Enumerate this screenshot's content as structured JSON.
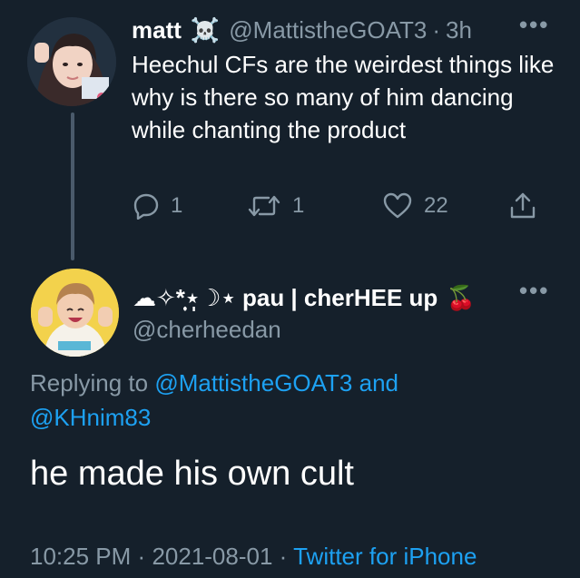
{
  "parent_tweet": {
    "display_name": "matt",
    "name_emoji": "☠️",
    "handle": "@MattistheGOAT3",
    "separator": "·",
    "time": "3h",
    "text": "Heechul CFs are the weirdest things like why is there so many of him dancing while chanting the product",
    "reply_count": "1",
    "retweet_count": "1",
    "like_count": "22",
    "avatar_icon": "profile-photo"
  },
  "reply_tweet": {
    "display_name": "☁︎✧*̣̩⋆̩☽⋆ pau | cherHEE up",
    "name_emoji": "🍒",
    "handle": "@cherheedan",
    "replying_prefix": "Replying to",
    "replying_user1": "@MattistheGOAT3",
    "replying_and": "and",
    "replying_user2": "@KHnim83",
    "text": "he made his own cult",
    "time": "10:25 PM",
    "date": "2021-08-01",
    "sep": "·",
    "source": "Twitter for iPhone",
    "avatar_icon": "profile-photo"
  },
  "more_icon": "•••",
  "colors": {
    "background": "#15202b",
    "secondary_text": "#8899a6",
    "link": "#1da1f2",
    "primary_text": "#ffffff"
  }
}
